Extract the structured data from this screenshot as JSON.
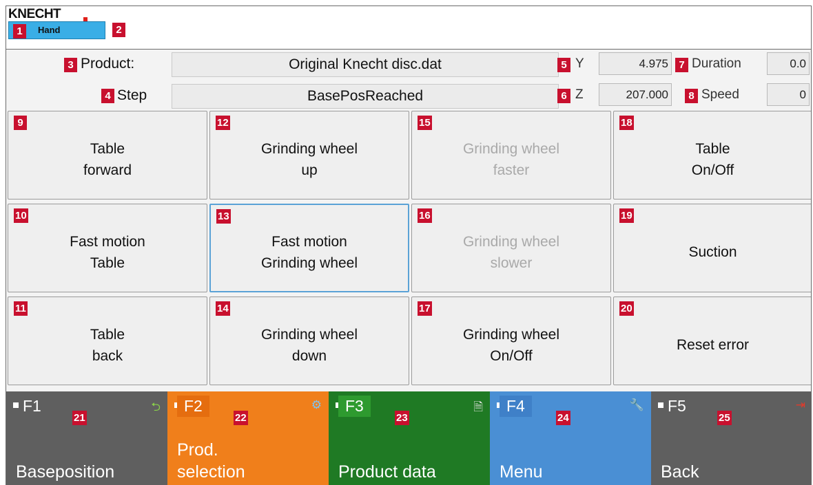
{
  "header": {
    "logo_text": "KNECHT",
    "mode_label": "Hand",
    "badge_mode": "1",
    "badge_area": "2"
  },
  "info": {
    "product_label": "Product:",
    "product_value": "Original Knecht disc.dat",
    "step_label": "Step",
    "step_value": "BasePosReached",
    "y_label": "Y",
    "y_value": "4.975",
    "z_label": "Z",
    "z_value": "207.000",
    "duration_label": "Duration",
    "duration_value": "0.0",
    "speed_label": "Speed",
    "speed_value": "0",
    "badges": {
      "product": "3",
      "step": "4",
      "y": "5",
      "z": "6",
      "duration": "7",
      "speed": "8"
    }
  },
  "buttons": [
    {
      "badge": "9",
      "label": "Table\nforward"
    },
    {
      "badge": "10",
      "label": "Fast motion\nTable"
    },
    {
      "badge": "11",
      "label": "Table\nback"
    },
    {
      "badge": "12",
      "label": "Grinding wheel\nup"
    },
    {
      "badge": "13",
      "label": "Fast motion\nGrinding wheel"
    },
    {
      "badge": "14",
      "label": "Grinding wheel\ndown"
    },
    {
      "badge": "15",
      "label": "Grinding wheel\nfaster"
    },
    {
      "badge": "16",
      "label": "Grinding wheel\nslower"
    },
    {
      "badge": "17",
      "label": "Grinding wheel\nOn/Off"
    },
    {
      "badge": "18",
      "label": "Table\nOn/Off"
    },
    {
      "badge": "19",
      "label": "Suction"
    },
    {
      "badge": "20",
      "label": "Reset error"
    }
  ],
  "fkeys": [
    {
      "key": "F1",
      "label": "Baseposition",
      "badge": "21",
      "color": "#5f5f5f",
      "key_bg": "",
      "icon": "undo-arrow-icon",
      "icon_glyph": "⮌",
      "icon_color": "#8ad14a"
    },
    {
      "key": "F2",
      "label": "Prod.\nselection",
      "badge": "22",
      "color": "#f07f1b",
      "key_bg": "#e56d0f",
      "icon": "gear-icon",
      "icon_glyph": "⚙",
      "icon_color": "#7fc4f0"
    },
    {
      "key": "F3",
      "label": "Product data",
      "badge": "23",
      "color": "#1f7a24",
      "key_bg": "#2e9a2f",
      "icon": "document-icon",
      "icon_glyph": "🗎",
      "icon_color": "#e8e8e8"
    },
    {
      "key": "F4",
      "label": "Menu",
      "badge": "24",
      "color": "#4a8fd4",
      "key_bg": "#3f80c8",
      "icon": "wrench-icon",
      "icon_glyph": "🔧",
      "icon_color": "#e23a2a"
    },
    {
      "key": "F5",
      "label": "Back",
      "badge": "25",
      "color": "#5f5f5f",
      "key_bg": "",
      "icon": "exit-door-icon",
      "icon_glyph": "⇥",
      "icon_color": "#e23a2a"
    }
  ]
}
